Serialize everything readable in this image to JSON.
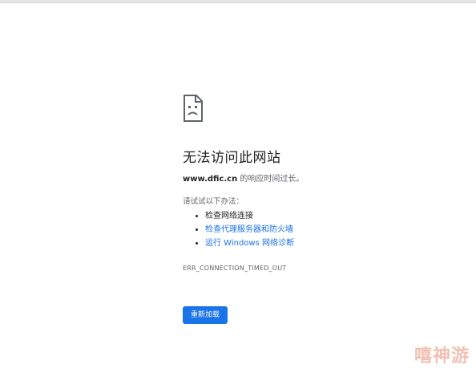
{
  "error_page": {
    "icon": "sad-page-icon",
    "title": "无法访问此网站",
    "host": "www.dfic.cn",
    "description_suffix": " 的响应时间过长。",
    "try_label": "请试试以下办法：",
    "suggestions": [
      "检查网络连接",
      "检查代理服务器和防火墙",
      "运行 Windows 网络诊断"
    ],
    "error_code": "ERR_CONNECTION_TIMED_OUT",
    "reload_label": "重新加载"
  },
  "watermark": "嘻神游",
  "colors": {
    "accent": "#1a73e8",
    "text": "#202124",
    "secondary_text": "#5f6368"
  }
}
